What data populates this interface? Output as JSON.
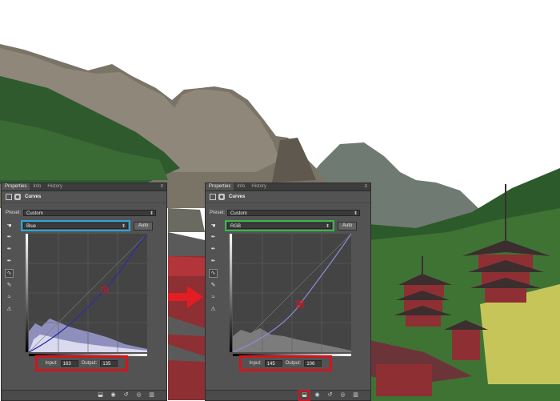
{
  "colors": {
    "blue_highlight": "#2aa5d9",
    "green_highlight": "#39b54a",
    "red_highlight": "#d3141c"
  },
  "panels": [
    {
      "tabs": [
        "Properties",
        "Info",
        "History"
      ],
      "title": "Curves",
      "preset_label": "Preset:",
      "preset_value": "Custom",
      "channel_value": "Blue",
      "auto_label": "Auto",
      "input_label": "Input:",
      "input_value": "163",
      "output_label": "Output:",
      "output_value": "135"
    },
    {
      "tabs": [
        "Properties",
        "Info",
        "History"
      ],
      "title": "Curves",
      "preset_label": "Preset:",
      "preset_value": "Custom",
      "channel_value": "RGB",
      "auto_label": "Auto",
      "input_label": "Input:",
      "input_value": "145",
      "output_label": "Output:",
      "output_value": "106"
    }
  ],
  "footer_icons": [
    "clip-to-layer-icon",
    "view-previous-icon",
    "reset-icon",
    "visibility-icon",
    "trash-icon"
  ],
  "tool_icons": [
    "target-adjust-icon",
    "black-eyedropper-icon",
    "gray-eyedropper-icon",
    "white-eyedropper-icon",
    "curve-points-icon",
    "pencil-icon",
    "smooth-icon",
    "clipping-warning-icon"
  ]
}
